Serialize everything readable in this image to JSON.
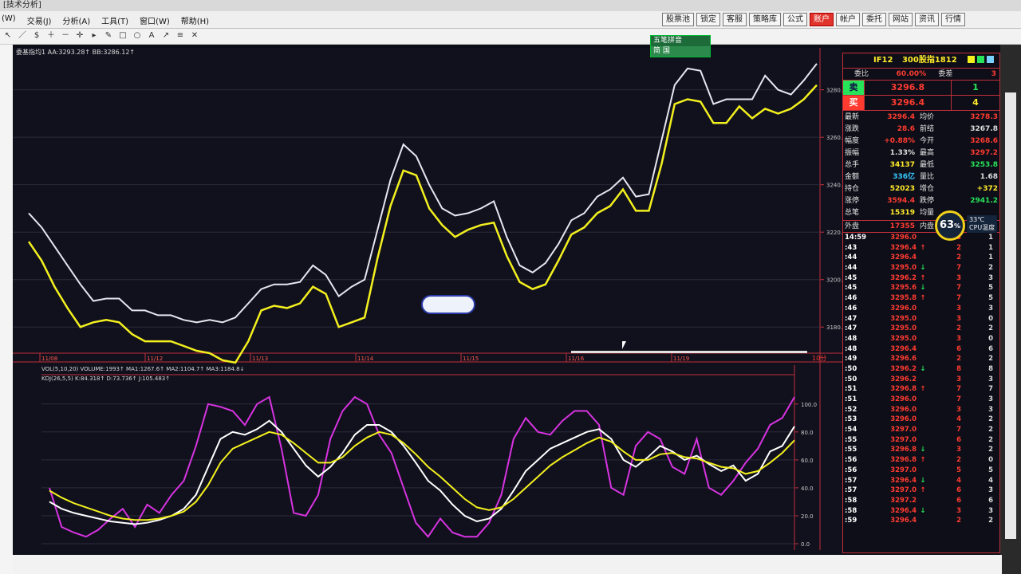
{
  "window": {
    "title": "[技术分析]"
  },
  "menu": {
    "items": [
      "(W)",
      "交易(J)",
      "分析(A)",
      "工具(T)",
      "窗口(W)",
      "帮助(H)"
    ]
  },
  "topbuttons": [
    {
      "label": "股票池",
      "active": false
    },
    {
      "label": "锁定",
      "active": false
    },
    {
      "label": "客服",
      "active": false
    },
    {
      "label": "策略库",
      "active": false
    },
    {
      "label": "公式",
      "active": false
    },
    {
      "label": "账户",
      "active": true
    },
    {
      "label": "帐户",
      "active": false
    },
    {
      "label": "委托",
      "active": false
    },
    {
      "label": "网站",
      "active": false
    },
    {
      "label": "资讯",
      "active": false
    },
    {
      "label": "行情",
      "active": false
    }
  ],
  "floatpanel": {
    "title": "五笔拼音",
    "sub": "简 国"
  },
  "main_chart": {
    "header": "委基指均1 AA:3293.28↑ BB:3286.12↑",
    "yticks": [
      "3280.0",
      "3260.0",
      "3240.0",
      "3220.0",
      "3200.0",
      "3180.0"
    ],
    "ytick_values": [
      3280,
      3260,
      3240,
      3220,
      3200,
      3180
    ],
    "xlabels": [
      "11/08",
      "11/12",
      "11/13",
      "11/14",
      "11/15",
      "11/16",
      "11/19"
    ],
    "corner": "10分",
    "series_AA": [
      3228,
      3222,
      3214,
      3206,
      3198,
      3191,
      3192,
      3192,
      3187,
      3187,
      3185,
      3185,
      3183,
      3182,
      3183,
      3182,
      3184,
      3190,
      3196,
      3198,
      3198,
      3199,
      3206,
      3202,
      3193,
      3197,
      3200,
      3221,
      3242,
      3257,
      3252,
      3240,
      3230,
      3227,
      3228,
      3230,
      3233,
      3218,
      3206,
      3203,
      3207,
      3215,
      3225,
      3228,
      3235,
      3238,
      3243,
      3235,
      3236,
      3259,
      3282,
      3289,
      3288,
      3274,
      3276,
      3276,
      3276,
      3286,
      3280,
      3278,
      3284,
      3291
    ],
    "series_BB": [
      3216,
      3208,
      3197,
      3188,
      3180,
      3182,
      3183,
      3182,
      3177,
      3174,
      3174,
      3174,
      3172,
      3170,
      3169,
      3166,
      3165,
      3174,
      3187,
      3189,
      3188,
      3190,
      3197,
      3194,
      3180,
      3182,
      3184,
      3209,
      3231,
      3246,
      3244,
      3230,
      3223,
      3218,
      3221,
      3223,
      3224,
      3210,
      3199,
      3196,
      3198,
      3208,
      3219,
      3222,
      3228,
      3231,
      3238,
      3229,
      3229,
      3249,
      3274,
      3276,
      3275,
      3266,
      3266,
      3273,
      3268,
      3272,
      3270,
      3272,
      3276,
      3282
    ]
  },
  "vol_header": "VOL(5,10,20) VOLUME:1993↑ MA1:1267.6↑ MA2:1104.7↑ MA3:1184.8↓",
  "kdj_chart": {
    "header": "KDJ(26,5,5) K:84.318↑ D:73.736↑ J:105.483↑",
    "yticks": [
      "100.0",
      "80.0",
      "60.0",
      "40.0",
      "20.0",
      "0.0"
    ],
    "ytick_values": [
      100,
      80,
      60,
      40,
      20,
      0
    ],
    "series_K": [
      30,
      25,
      22,
      20,
      18,
      16,
      15,
      14,
      15,
      17,
      20,
      25,
      35,
      55,
      75,
      80,
      78,
      82,
      88,
      80,
      68,
      56,
      48,
      55,
      65,
      78,
      85,
      85,
      80,
      70,
      58,
      45,
      38,
      28,
      20,
      16,
      18,
      25,
      38,
      52,
      60,
      68,
      72,
      76,
      80,
      82,
      75,
      60,
      55,
      62,
      70,
      66,
      60,
      63,
      57,
      52,
      56,
      45,
      50,
      66,
      70,
      84
    ],
    "series_D": [
      38,
      33,
      29,
      26,
      23,
      20,
      18,
      17,
      17,
      18,
      20,
      23,
      30,
      42,
      58,
      68,
      72,
      76,
      80,
      78,
      72,
      65,
      58,
      58,
      62,
      70,
      76,
      80,
      78,
      72,
      64,
      55,
      48,
      40,
      32,
      26,
      24,
      26,
      32,
      40,
      48,
      56,
      62,
      67,
      72,
      76,
      73,
      66,
      60,
      60,
      64,
      65,
      62,
      61,
      58,
      55,
      54,
      50,
      52,
      58,
      65,
      74
    ],
    "series_J": [
      40,
      12,
      8,
      5,
      10,
      18,
      25,
      12,
      28,
      22,
      35,
      45,
      70,
      100,
      98,
      95,
      85,
      100,
      105,
      68,
      22,
      20,
      35,
      75,
      95,
      105,
      100,
      78,
      65,
      40,
      15,
      5,
      18,
      8,
      5,
      5,
      15,
      35,
      75,
      90,
      80,
      78,
      88,
      95,
      95,
      85,
      40,
      35,
      70,
      80,
      75,
      55,
      50,
      75,
      40,
      35,
      45,
      58,
      68,
      85,
      90,
      105
    ]
  },
  "quote": {
    "code": "IF12",
    "name": "300股指1812",
    "wei_bi_label": "委比",
    "wei_bi": "60.00%",
    "wei_cha_label": "委差",
    "wei_cha": "3",
    "sell_label": "卖",
    "sell_price": "3296.8",
    "sell_qty": "1",
    "buy_label": "买",
    "buy_price": "3296.4",
    "buy_qty": "4",
    "stats": [
      {
        "k": "最新",
        "v": "3296.4",
        "vc": "#ff3b30",
        "k2": "均价",
        "v2": "3278.3",
        "v2c": "#ff3b30"
      },
      {
        "k": "涨跌",
        "v": "28.6",
        "vc": "#ff3b30",
        "k2": "前结",
        "v2": "3267.8",
        "v2c": "#dddddd"
      },
      {
        "k": "幅度",
        "v": "+0.88%",
        "vc": "#ff3b30",
        "k2": "今开",
        "v2": "3268.6",
        "v2c": "#ff3b30"
      },
      {
        "k": "振幅",
        "v": "1.33%",
        "vc": "#dddddd",
        "k2": "最高",
        "v2": "3297.2",
        "v2c": "#ff3b30"
      },
      {
        "k": "总手",
        "v": "34137",
        "vc": "#ffeb2a",
        "k2": "最低",
        "v2": "3253.8",
        "v2c": "#27e35a"
      },
      {
        "k": "金额",
        "v": "336亿",
        "vc": "#37c8ff",
        "k2": "量比",
        "v2": "1.68",
        "v2c": "#dddddd"
      },
      {
        "k": "持仓",
        "v": "52023",
        "vc": "#ffeb2a",
        "k2": "增仓",
        "v2": "+372",
        "v2c": "#ffeb2a"
      },
      {
        "k": "涨停",
        "v": "3594.4",
        "vc": "#ff3b30",
        "k2": "跌停",
        "v2": "2941.2",
        "v2c": "#27e35a"
      },
      {
        "k": "总笔",
        "v": "15319",
        "vc": "#ffeb2a",
        "k2": "均量",
        "v2": "",
        "v2c": "#dddddd"
      }
    ],
    "wai_pan_label": "外盘",
    "wai_pan": "17355",
    "nei_pan_label": "内盘"
  },
  "trades": [
    {
      "t": "14:59",
      "p": "3296.0",
      "a": "",
      "v": "3",
      "n": "1"
    },
    {
      "t": ":43",
      "p": "3296.4",
      "a": "↑",
      "v": "2",
      "n": "1"
    },
    {
      "t": ":44",
      "p": "3296.4",
      "a": "",
      "v": "2",
      "n": "1"
    },
    {
      "t": ":44",
      "p": "3295.0",
      "a": "↓",
      "v": "7",
      "n": "2"
    },
    {
      "t": ":45",
      "p": "3296.2",
      "a": "↑",
      "v": "3",
      "n": "3"
    },
    {
      "t": ":45",
      "p": "3295.6",
      "a": "↓",
      "v": "7",
      "n": "5"
    },
    {
      "t": ":46",
      "p": "3295.8",
      "a": "↑",
      "v": "7",
      "n": "5"
    },
    {
      "t": ":46",
      "p": "3296.0",
      "a": "",
      "v": "3",
      "n": "3"
    },
    {
      "t": ":47",
      "p": "3295.0",
      "a": "",
      "v": "3",
      "n": "0"
    },
    {
      "t": ":47",
      "p": "3295.0",
      "a": "",
      "v": "2",
      "n": "2"
    },
    {
      "t": ":48",
      "p": "3295.0",
      "a": "",
      "v": "3",
      "n": "0"
    },
    {
      "t": ":48",
      "p": "3296.4",
      "a": "",
      "v": "6",
      "n": "6"
    },
    {
      "t": ":49",
      "p": "3296.6",
      "a": "",
      "v": "2",
      "n": "2"
    },
    {
      "t": ":50",
      "p": "3296.2",
      "a": "↓",
      "v": "8",
      "n": "8"
    },
    {
      "t": ":50",
      "p": "3296.2",
      "a": "",
      "v": "3",
      "n": "3"
    },
    {
      "t": ":51",
      "p": "3296.8",
      "a": "↑",
      "v": "7",
      "n": "7"
    },
    {
      "t": ":51",
      "p": "3296.0",
      "a": "",
      "v": "7",
      "n": "3"
    },
    {
      "t": ":52",
      "p": "3296.0",
      "a": "",
      "v": "3",
      "n": "3"
    },
    {
      "t": ":53",
      "p": "3296.0",
      "a": "",
      "v": "4",
      "n": "2"
    },
    {
      "t": ":54",
      "p": "3297.0",
      "a": "",
      "v": "7",
      "n": "2"
    },
    {
      "t": ":55",
      "p": "3297.0",
      "a": "",
      "v": "6",
      "n": "2"
    },
    {
      "t": ":55",
      "p": "3296.8",
      "a": "↓",
      "v": "3",
      "n": "2"
    },
    {
      "t": ":56",
      "p": "3296.8",
      "a": "↑",
      "v": "2",
      "n": "0"
    },
    {
      "t": ":56",
      "p": "3297.0",
      "a": "",
      "v": "5",
      "n": "5"
    },
    {
      "t": ":57",
      "p": "3296.4",
      "a": "↓",
      "v": "4",
      "n": "4"
    },
    {
      "t": ":57",
      "p": "3297.0",
      "a": "↑",
      "v": "6",
      "n": "3"
    },
    {
      "t": ":58",
      "p": "3297.2",
      "a": "",
      "v": "6",
      "n": "6"
    },
    {
      "t": ":58",
      "p": "3296.4",
      "a": "↓",
      "v": "3",
      "n": "3"
    },
    {
      "t": ":59",
      "p": "3296.4",
      "a": "",
      "v": "2",
      "n": "2"
    }
  ],
  "cpu": {
    "value": "63",
    "unit": "%",
    "temp": "33℃",
    "label": "CPU温度"
  },
  "colors": {
    "aa": "#e6e6f0",
    "bb": "#f3f01e",
    "j": "#d733e0",
    "grid_red": "#c0303a",
    "up": "#ff3b30",
    "down": "#27e35a"
  }
}
